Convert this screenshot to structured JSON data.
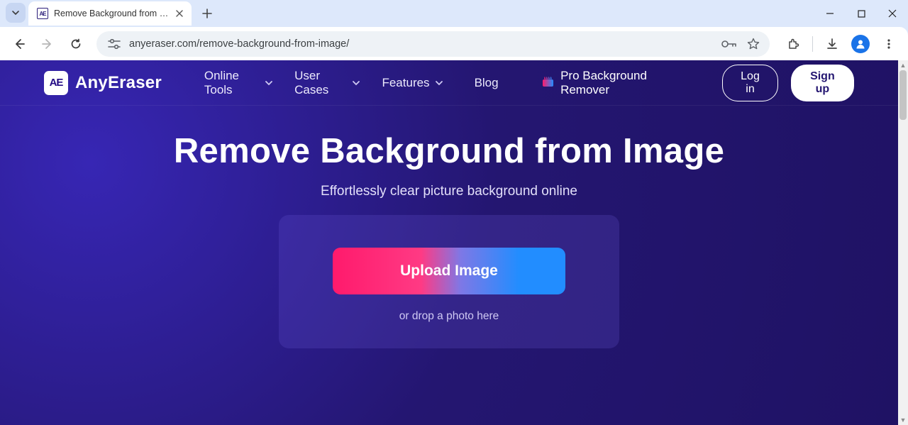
{
  "browser": {
    "tab_title": "Remove Background from Imag",
    "url": "anyeraser.com/remove-background-from-image/"
  },
  "site": {
    "brand_logo_text": "AE",
    "brand_name": "AnyEraser",
    "nav": {
      "online_tools": "Online Tools",
      "user_cases": "User Cases",
      "features": "Features",
      "blog": "Blog",
      "pro": "Pro Background Remover"
    },
    "auth": {
      "login": "Log in",
      "signup": "Sign up"
    }
  },
  "hero": {
    "title": "Remove Background from Image",
    "subtitle": "Effortlessly clear picture background online",
    "upload_label": "Upload Image",
    "drop_hint": "or drop a photo here"
  }
}
